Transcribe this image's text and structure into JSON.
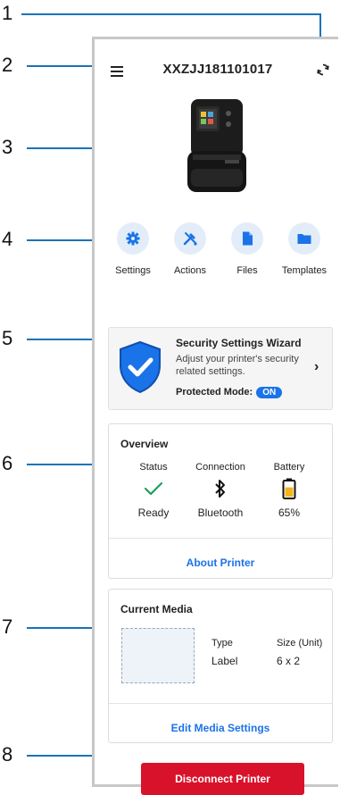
{
  "callouts": [
    "1",
    "2",
    "3",
    "4",
    "5",
    "6",
    "7",
    "8"
  ],
  "header": {
    "title": "XXZJJ181101017",
    "menu_icon": "hamburger-menu-icon",
    "sync_icon": "sync-icon"
  },
  "actions": [
    {
      "label": "Settings",
      "icon": "gear-icon"
    },
    {
      "label": "Actions",
      "icon": "tools-icon"
    },
    {
      "label": "Files",
      "icon": "file-icon"
    },
    {
      "label": "Templates",
      "icon": "folder-icon"
    }
  ],
  "wizard": {
    "title": "Security Settings Wizard",
    "description": "Adjust your printer's security related settings.",
    "mode_label": "Protected Mode:",
    "mode_value": "ON"
  },
  "overview": {
    "title": "Overview",
    "columns": [
      {
        "header": "Status",
        "value": "Ready",
        "icon": "checkmark-icon"
      },
      {
        "header": "Connection",
        "value": "Bluetooth",
        "icon": "bluetooth-icon"
      },
      {
        "header": "Battery",
        "value": "65%",
        "icon": "battery-icon"
      }
    ],
    "link": "About Printer"
  },
  "media": {
    "title": "Current Media",
    "type_header": "Type",
    "type_value": "Label",
    "size_header": "Size (Unit)",
    "size_value": "6 x 2",
    "link": "Edit Media Settings"
  },
  "disconnect_label": "Disconnect Printer",
  "colors": {
    "accent": "#1a73e8",
    "callout_line": "#1a73b8",
    "danger": "#d9122b",
    "check": "#1e9e5a",
    "battery": "#f2b51c"
  }
}
